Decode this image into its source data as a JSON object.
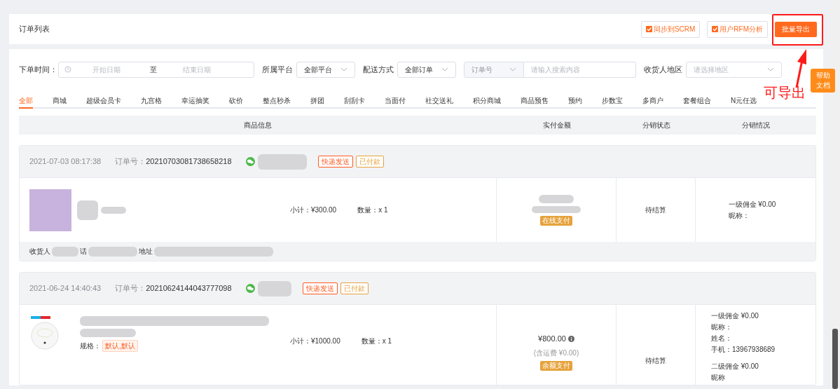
{
  "page_title": "订单列表",
  "toolbar_buttons": [
    {
      "label": "同步到SCRM",
      "kind": "outline"
    },
    {
      "label": "用户RFM分析",
      "kind": "outline"
    },
    {
      "label": "批量导出",
      "kind": "primary"
    }
  ],
  "filters": {
    "date_label": "下单时间：",
    "start_placeholder": "开始日期",
    "range_separator": "至",
    "end_placeholder": "结束日期",
    "platform_label": "所属平台",
    "platform_value": "全部平台",
    "delivery_label": "配送方式",
    "delivery_value": "全部订单",
    "search_type": "订单号",
    "search_placeholder": "请输入搜索内容",
    "region_label": "收货人地区",
    "region_placeholder": "请选择地区"
  },
  "tabs": [
    {
      "label": "全部",
      "selected": true
    },
    {
      "label": "商城",
      "selected": false
    },
    {
      "label": "超级会员卡",
      "selected": false
    },
    {
      "label": "九宫格",
      "selected": false
    },
    {
      "label": "幸运抽奖",
      "selected": false
    },
    {
      "label": "砍价",
      "selected": false
    },
    {
      "label": "整点秒杀",
      "selected": false
    },
    {
      "label": "拼团",
      "selected": false
    },
    {
      "label": "刮刮卡",
      "selected": false
    },
    {
      "label": "当面付",
      "selected": false
    },
    {
      "label": "社交送礼",
      "selected": false
    },
    {
      "label": "积分商城",
      "selected": false
    },
    {
      "label": "商品预售",
      "selected": false
    },
    {
      "label": "预约",
      "selected": false
    },
    {
      "label": "步数宝",
      "selected": false
    },
    {
      "label": "多商户",
      "selected": false
    },
    {
      "label": "套餐组合",
      "selected": false
    },
    {
      "label": "N元任选",
      "selected": false
    }
  ],
  "table": {
    "columns": [
      "商品信息",
      "实付金额",
      "分销状态",
      "分销情况"
    ]
  },
  "orders": [
    {
      "time": "2021-07-03 08:17:38",
      "order_no_label": "订单号：",
      "order_no": "20210703081738658218",
      "tags": [
        {
          "label": "快递发送",
          "color": "#ff5a1f"
        },
        {
          "label": "已付款",
          "color": "#e6a23c"
        }
      ],
      "product": {
        "kind": "photo",
        "subtotal": "小计：¥300.00",
        "quantity": "数量：x 1"
      },
      "amount": {
        "pay_badge": "在线支付"
      },
      "status": "待结算",
      "distribution": [
        {
          "lines": [
            "一级佣金 ¥0.00",
            "昵称："
          ]
        }
      ],
      "footer": [
        "收货人",
        "话",
        "地址"
      ]
    },
    {
      "time": "2021-06-24 14:40:43",
      "order_no_label": "订单号：",
      "order_no": "20210624144043777098",
      "tags": [
        {
          "label": "快递发送",
          "color": "#ff5a1f"
        },
        {
          "label": "已付款",
          "color": "#e6a23c"
        }
      ],
      "product": {
        "kind": "robot",
        "spec_label": "规格：",
        "spec": "默认,默认",
        "subtotal": "小计：¥1000.00",
        "quantity": "数量：x 1"
      },
      "amount": {
        "total": "¥800.00",
        "shipping": "(含运费 ¥0.00)",
        "pay_badge": "余额支付"
      },
      "status": "待结算",
      "distribution": [
        {
          "lines": [
            "一级佣金 ¥0.00",
            "昵称：",
            "姓名：",
            "手机：13967938689"
          ]
        },
        {
          "lines": [
            "二级佣金 ¥0.00",
            "昵称"
          ]
        }
      ]
    }
  ],
  "help_button": {
    "lines": [
      "帮助",
      "文档"
    ]
  },
  "annotation": {
    "text": "可导出"
  }
}
